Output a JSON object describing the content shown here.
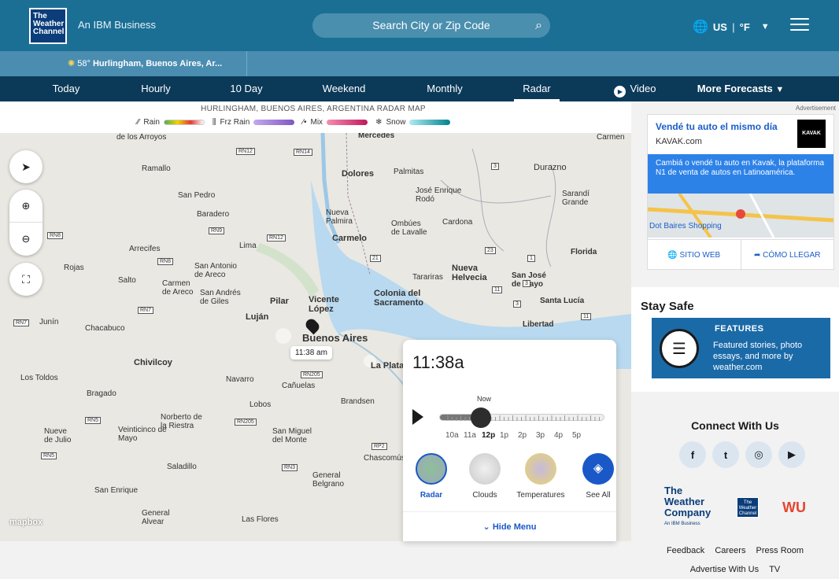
{
  "header": {
    "logo_text": "The Weather Channel",
    "tagline": "An IBM Business",
    "search_placeholder": "Search City or Zip Code",
    "country": "US",
    "unit": "°F"
  },
  "recent": {
    "temp": "58°",
    "location": "Hurlingham, Buenos Aires, Ar..."
  },
  "nav": {
    "tabs": [
      {
        "label": "Today"
      },
      {
        "label": "Hourly"
      },
      {
        "label": "10 Day"
      },
      {
        "label": "Weekend"
      },
      {
        "label": "Monthly"
      },
      {
        "label": "Radar"
      },
      {
        "label": "Video"
      },
      {
        "label": "More Forecasts"
      }
    ]
  },
  "map": {
    "title": "HURLINGHAM, BUENOS AIRES, ARGENTINA RADAR MAP",
    "legend": [
      {
        "label": "Rain"
      },
      {
        "label": "Frz Rain"
      },
      {
        "label": "Mix"
      },
      {
        "label": "Snow"
      }
    ],
    "legend_colors": {
      "rain": [
        "#4caf50",
        "#f2d400",
        "#e53935"
      ],
      "frz": [
        "#c5a9f0",
        "#7e57c2"
      ],
      "mix": [
        "#f48fb1",
        "#c2185b"
      ],
      "snow": [
        "#b2ebf2",
        "#00838f"
      ]
    },
    "places": [
      "de los Arroyos",
      "Mercedes",
      "Carmen",
      "Ramallo",
      "Dolores",
      "Palmitas",
      "Durazno",
      "San Pedro",
      "José Enrique Rodó",
      "Sarandí Grande",
      "Baradero",
      "Nueva Palmira",
      "Ombúes de Lavalle",
      "Cardona",
      "Carmelo",
      "Arrecifes",
      "Lima",
      "Florida",
      "Rojas",
      "San Antonio de Areco",
      "Nueva Helvecia",
      "Tarariras",
      "San José de Mayo",
      "Salto",
      "Carmen de Areco",
      "San Andrés de Giles",
      "Pilar",
      "Vicente López",
      "Colonia del Sacramento",
      "Santa Lucía",
      "Junín",
      "Chacabuco",
      "Luján",
      "Libertad",
      "Buenos Aires",
      "Chivilcoy",
      "Los Toldos",
      "Navarro",
      "Cañuelas",
      "Bragado",
      "Lobos",
      "Brandsen",
      "Norberto de la Riestra",
      "Nueve de Julio",
      "Veinticinco de Mayo",
      "San Miguel del Monte",
      "Chascomús",
      "Saladillo",
      "General Belgrano",
      "San Enrique",
      "General Alvear",
      "Las Flores",
      "La Plata"
    ],
    "roads": [
      "RN12",
      "RN14",
      "RN8",
      "RN9",
      "RN12",
      "RN8",
      "RN7",
      "RN7",
      "RN205",
      "RN5",
      "RN205",
      "RN5",
      "RN3",
      "RP2",
      "21",
      "23",
      "3",
      "1",
      "11",
      "3",
      "11",
      "3"
    ],
    "pin_time": "11:38 am",
    "attribution": "mapbox"
  },
  "player": {
    "time": "11:38a",
    "now_label": "Now",
    "progress": 0.25,
    "ticks": [
      "10a",
      "11a",
      "12p",
      "1p",
      "2p",
      "3p",
      "4p",
      "5p"
    ],
    "layers": [
      {
        "label": "Radar"
      },
      {
        "label": "Clouds"
      },
      {
        "label": "Temperatures"
      },
      {
        "label": "See All"
      }
    ],
    "hide_label": "Hide Menu"
  },
  "ad": {
    "label": "Advertisement",
    "headline": "Vendé tu auto el mismo día",
    "url": "KAVAK.com",
    "brand": "KAVAK",
    "body": "Cambiá o vendé tu auto en Kavak, la plataforma N1 de venta de autos en Latinoamérica.",
    "map_label": "Dot Baires Shopping",
    "cta1": "SITIO WEB",
    "cta2": "CÓMO LLEGAR"
  },
  "aside": {
    "safe_title": "Stay Safe",
    "feature_tag": "FEATURES",
    "feature_text": "Featured stories, photo essays, and more by weather.com",
    "connect_title": "Connect With Us",
    "social": [
      "f",
      "t",
      "◎",
      "▶"
    ],
    "brand_twc": "The Weather Company",
    "brand_twc_sub": "An IBM Business",
    "brand_tile": "The Weather Channel",
    "brand_wu": "WU",
    "links_row1": [
      "Feedback",
      "Careers",
      "Press Room"
    ],
    "links_row2": [
      "Advertise With Us",
      "TV"
    ]
  }
}
